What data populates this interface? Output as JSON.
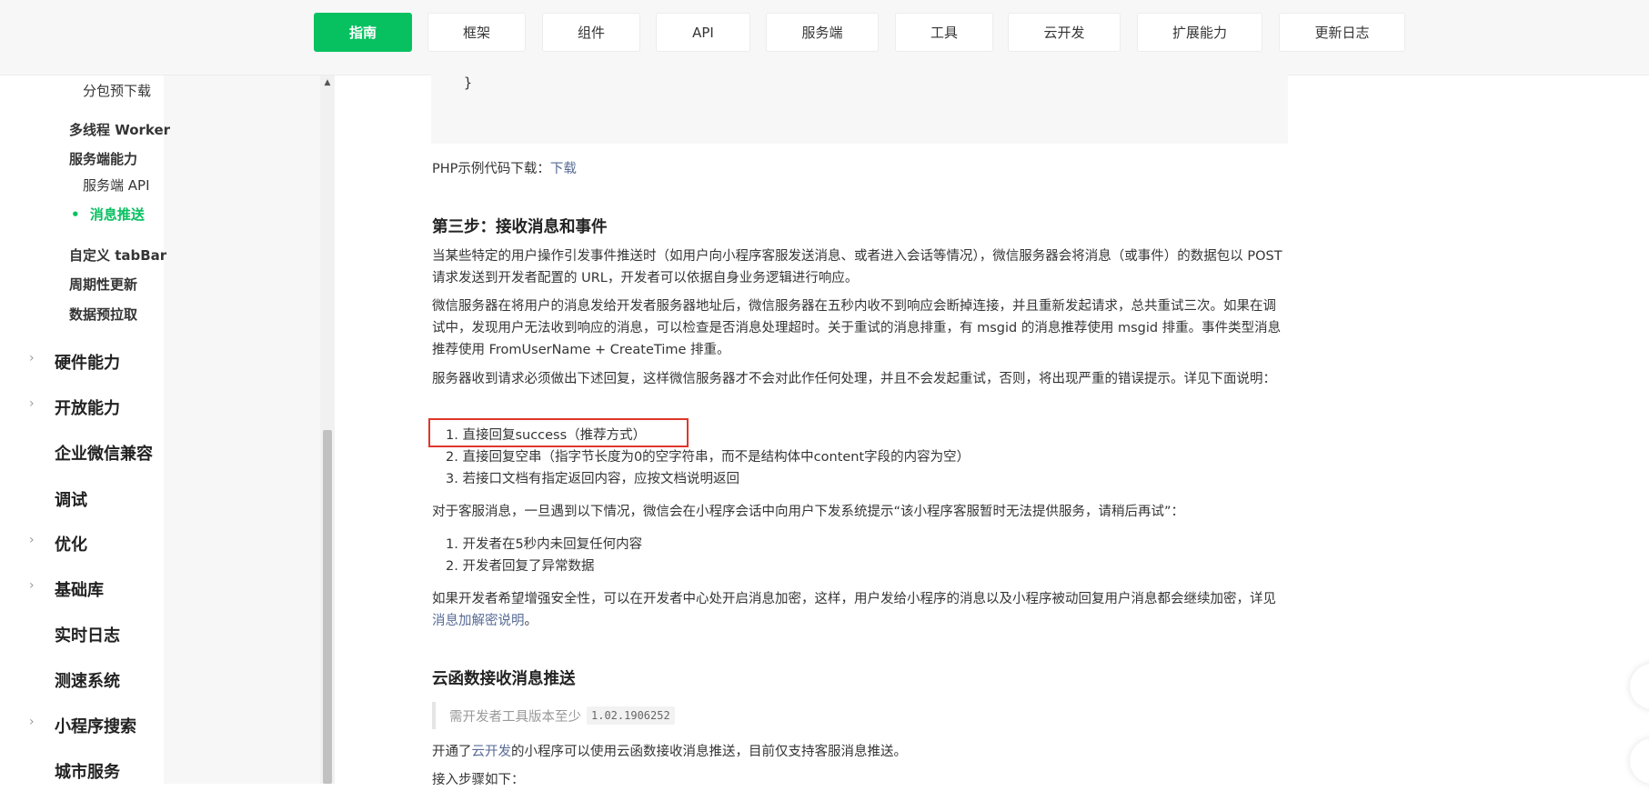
{
  "nav": {
    "tabs": [
      "指南",
      "框架",
      "组件",
      "API",
      "服务端",
      "工具",
      "云开发",
      "扩展能力",
      "更新日志"
    ],
    "active_index": 0
  },
  "sidebar": {
    "items": [
      "分包预下载",
      "多线程 Worker",
      "服务端能力",
      "服务端 API",
      "消息推送",
      "自定义 tabBar",
      "周期性更新",
      "数据预拉取",
      "硬件能力",
      "开放能力",
      "企业微信兼容",
      "调试",
      "优化",
      "基础库",
      "实时日志",
      "测速系统",
      "小程序搜索",
      "城市服务"
    ],
    "active_item": "消息推送",
    "bullet": "•",
    "caret": "›",
    "scroll_up": "▲"
  },
  "content": {
    "code_tail": "}",
    "php_download": {
      "label": "PHP示例代码下载：",
      "link": "下载"
    },
    "step3_title": "第三步：接收消息和事件",
    "p1": "当某些特定的用户操作引发事件推送时（如用户向小程序客服发送消息、或者进入会话等情况），微信服务器会将消息（或事件）的数据包以 POST 请求发送到开发者配置的 URL，开发者可以依据自身业务逻辑进行响应。",
    "p2": "微信服务器在将用户的消息发给开发者服务器地址后，微信服务器在五秒内收不到响应会断掉连接，并且重新发起请求，总共重试三次。如果在调试中，发现用户无法收到响应的消息，可以检查是否消息处理超时。关于重试的消息排重，有 msgid 的消息推荐使用 msgid 排重。事件类型消息推荐使用 FromUserName + CreateTime 排重。",
    "p3": "服务器收到请求必须做出下述回复，这样微信服务器才不会对此作任何处理，并且不会发起重试，否则，将出现严重的错误提示。详见下面说明：",
    "list1": [
      "1. 直接回复success（推荐方式）",
      "2. 直接回复空串（指字节长度为0的空字符串，而不是结构体中content字段的内容为空）",
      "3. 若接口文档有指定返回内容，应按文档说明返回"
    ],
    "p4": "对于客服消息，一旦遇到以下情况，微信会在小程序会话中向用户下发系统提示“该小程序客服暂时无法提供服务，请稍后再试”：",
    "list2": [
      "1. 开发者在5秒内未回复任何内容",
      "2. 开发者回复了异常数据"
    ],
    "p5_prefix": "如果开发者希望增强安全性，可以在开发者中心处开启消息加密，这样，用户发给小程序的消息以及小程序被动回复用户消息都会继续加密，详见",
    "p5_link": "消息加解密说明",
    "p5_suffix": "。",
    "cloud_title": "云函数接收消息推送",
    "note_text": "需开发者工具版本至少",
    "note_version": "1.02.1906252",
    "p6_prefix": "开通了",
    "p6_link": "云开发",
    "p6_suffix": "的小程序可以使用云函数接收消息推送，目前仅支持客服消息推送。",
    "p7": "接入步骤如下："
  },
  "colors": {
    "accent": "#07c160",
    "link": "#576b95",
    "highlight_box": "#e0362c"
  }
}
